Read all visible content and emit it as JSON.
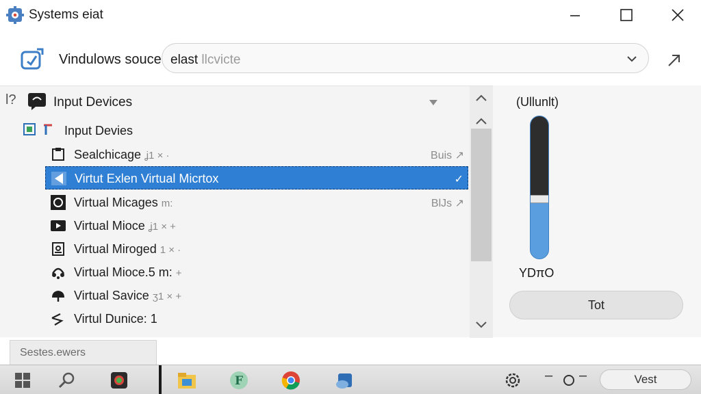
{
  "window": {
    "title": "Systems eiat",
    "controls": {
      "minimize_icon": "minimize-icon",
      "maximize_icon": "maximize-icon",
      "close_icon": "close-icon"
    }
  },
  "source": {
    "label": "Vindulows souce",
    "combo_prefix": "elast",
    "combo_value": "llcvicte"
  },
  "list": {
    "help": "l?",
    "header": "Input Devices",
    "subheader": "Input Devies",
    "items": [
      {
        "label": "Sealchicage",
        "suffix": "ʝ1 × ·",
        "right": "Buis ↗",
        "icon": "device-icon"
      },
      {
        "label": "Virtut Exlen Virtual Micrtox",
        "suffix": "",
        "right": "✓",
        "icon": "microphone-icon"
      },
      {
        "label": "Virtual Micages",
        "suffix": "m:",
        "right": "BlJs ↗",
        "icon": "speaker-icon"
      },
      {
        "label": "Virtual Mioce",
        "suffix": "ʝ1 × +",
        "right": "",
        "icon": "camera-icon"
      },
      {
        "label": "Virtual Miroged",
        "suffix": "1 × ·",
        "right": "",
        "icon": "lock-icon"
      },
      {
        "label": "Virtual Mioce.5 m:",
        "suffix": "+",
        "right": "",
        "icon": "headset-icon"
      },
      {
        "label": "Virtual Savice",
        "suffix": "ʒ1 × +",
        "right": "",
        "icon": "cloud-icon"
      },
      {
        "label": "Virtul Dunice: 1",
        "suffix": "",
        "right": "",
        "icon": "wave-icon"
      }
    ]
  },
  "meter": {
    "label": "(Ullunlt)",
    "value_text": "YDπO",
    "level": 0.42,
    "test_button": "Tot"
  },
  "status": {
    "tab_label": "Sestes.ewers"
  },
  "taskbar": {
    "items": [
      "windows-start-icon",
      "search-icon",
      "app-icon",
      "folder-icon",
      "app-f-icon",
      "chrome-icon",
      "store-icon"
    ],
    "tray_button": "Vest"
  },
  "colors": {
    "selection": "#2f7fd4",
    "meter_fill": "#5b9ee0",
    "meter_top": "#2d2d2d"
  }
}
